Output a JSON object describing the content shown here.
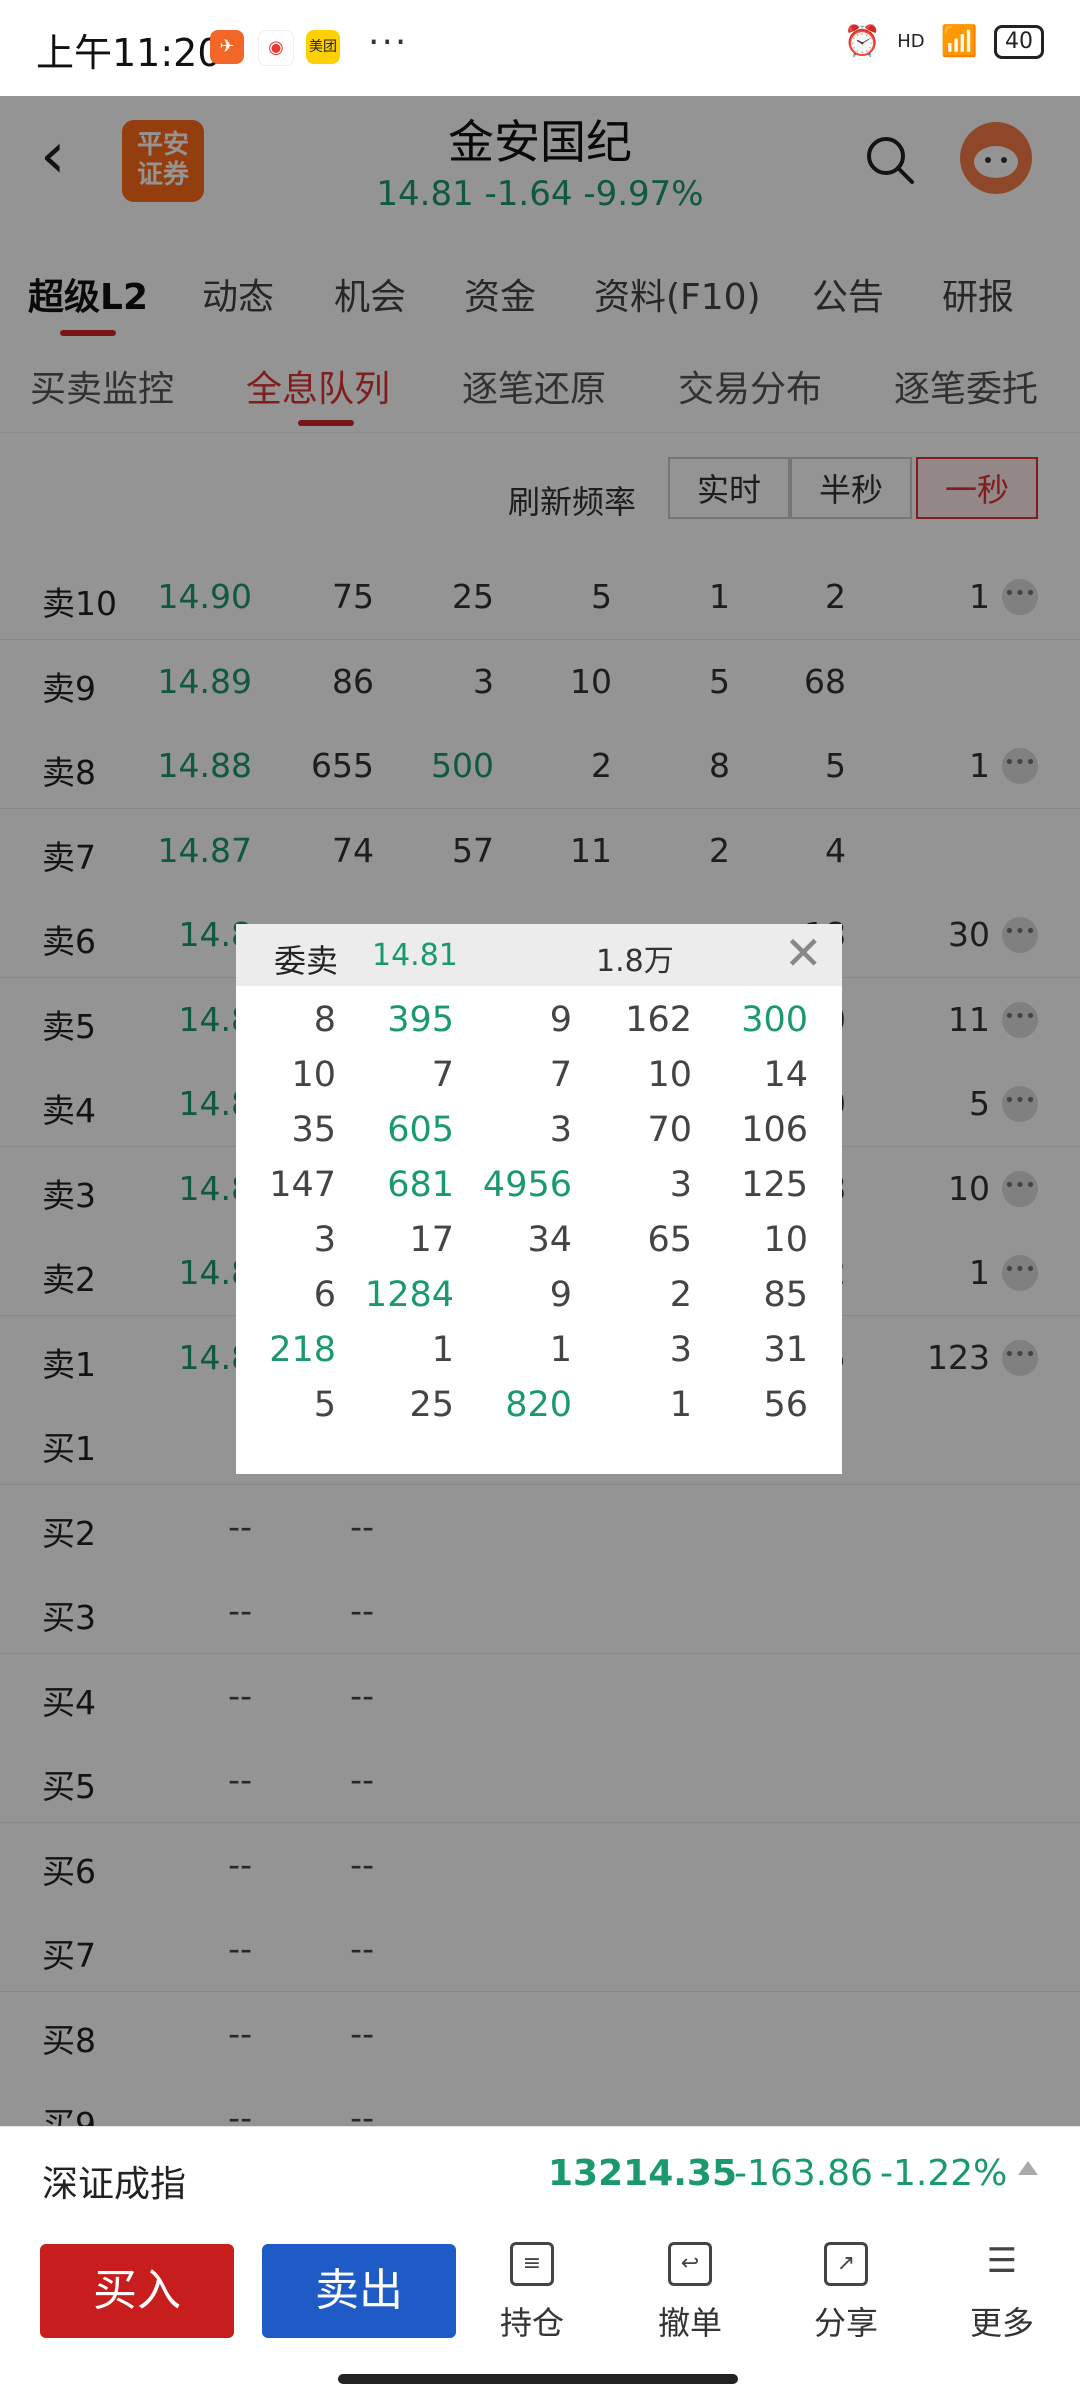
{
  "status": {
    "time": "上午11:20",
    "hd": "HD",
    "battery": "40",
    "dots": "···",
    "meituan": "美团"
  },
  "header": {
    "logo_line1": "平安",
    "logo_line2": "证券",
    "stock_name": "金安国纪",
    "quote": "14.81  -1.64  -9.97%"
  },
  "tabs1": [
    "超级L2",
    "动态",
    "机会",
    "资金",
    "资料(F10)",
    "公告",
    "研报"
  ],
  "tabs2": [
    "买卖监控",
    "全息队列",
    "逐笔还原",
    "交易分布",
    "逐笔委托"
  ],
  "refresh": {
    "label": "刷新频率",
    "options": [
      "实时",
      "半秒",
      "一秒"
    ],
    "selected": "一秒"
  },
  "sell_rows": [
    {
      "label": "卖10",
      "price": "14.90",
      "vol": "75",
      "q": [
        "25",
        "5",
        "1",
        "2",
        "1"
      ]
    },
    {
      "label": "卖9",
      "price": "14.89",
      "vol": "86",
      "q": [
        "3",
        "10",
        "5",
        "68",
        ""
      ]
    },
    {
      "label": "卖8",
      "price": "14.88",
      "vol": "655",
      "q": [
        "500",
        "2",
        "8",
        "5",
        "1"
      ]
    },
    {
      "label": "卖7",
      "price": "14.87",
      "vol": "74",
      "q": [
        "57",
        "11",
        "2",
        "4",
        ""
      ]
    },
    {
      "label": "卖6",
      "price": "14.8",
      "vol": "",
      "q": [
        "",
        "",
        "",
        "18",
        "30"
      ]
    },
    {
      "label": "卖5",
      "price": "14.8",
      "vol": "",
      "q": [
        "",
        "",
        "",
        "0",
        "11"
      ]
    },
    {
      "label": "卖4",
      "price": "14.8",
      "vol": "",
      "q": [
        "",
        "",
        "",
        "0",
        "5"
      ]
    },
    {
      "label": "卖3",
      "price": "14.8",
      "vol": "",
      "q": [
        "",
        "",
        "",
        "8",
        "10"
      ]
    },
    {
      "label": "卖2",
      "price": "14.8",
      "vol": "",
      "q": [
        "",
        "",
        "",
        "2",
        "1"
      ]
    },
    {
      "label": "卖1",
      "price": "14.8",
      "vol": "",
      "q": [
        "",
        "",
        "",
        "5",
        "123"
      ]
    }
  ],
  "buy_rows": [
    {
      "label": "买1",
      "price": "-",
      "vol": ""
    },
    {
      "label": "买2",
      "price": "--",
      "vol": "--"
    },
    {
      "label": "买3",
      "price": "--",
      "vol": "--"
    },
    {
      "label": "买4",
      "price": "--",
      "vol": "--"
    },
    {
      "label": "买5",
      "price": "--",
      "vol": "--"
    },
    {
      "label": "买6",
      "price": "--",
      "vol": "--"
    },
    {
      "label": "买7",
      "price": "--",
      "vol": "--"
    },
    {
      "label": "买8",
      "price": "--",
      "vol": "--"
    },
    {
      "label": "买9",
      "price": "--",
      "vol": "--"
    }
  ],
  "popup": {
    "title": "委卖",
    "price": "14.81",
    "total": "1.8万",
    "rows": [
      [
        "8",
        "395",
        "9",
        "162",
        "300"
      ],
      [
        "10",
        "7",
        "7",
        "10",
        "14"
      ],
      [
        "35",
        "605",
        "3",
        "70",
        "106"
      ],
      [
        "147",
        "681",
        "4956",
        "3",
        "125"
      ],
      [
        "3",
        "17",
        "34",
        "65",
        "10"
      ],
      [
        "6",
        "1284",
        "9",
        "2",
        "85"
      ],
      [
        "218",
        "1",
        "1",
        "3",
        "31"
      ],
      [
        "5",
        "25",
        "820",
        "1",
        "56"
      ]
    ],
    "green": [
      [
        false,
        true,
        false,
        false,
        true
      ],
      [
        false,
        false,
        false,
        false,
        false
      ],
      [
        false,
        true,
        false,
        false,
        false
      ],
      [
        false,
        true,
        true,
        false,
        false
      ],
      [
        false,
        false,
        false,
        false,
        false
      ],
      [
        false,
        true,
        false,
        false,
        false
      ],
      [
        true,
        false,
        false,
        false,
        false
      ],
      [
        false,
        false,
        true,
        false,
        false
      ]
    ]
  },
  "index": {
    "name": "深证成指",
    "value": "13214.35",
    "change": "-163.86",
    "pct": "-1.22%"
  },
  "actions": {
    "buy": "买入",
    "sell": "卖出",
    "items": [
      "持仓",
      "撤单",
      "分享",
      "更多"
    ]
  },
  "colors": {
    "down_green": "#1a9a6c",
    "buy_red": "#c81d1d",
    "sell_blue": "#1e5bc6",
    "accent_red": "#d32525"
  }
}
